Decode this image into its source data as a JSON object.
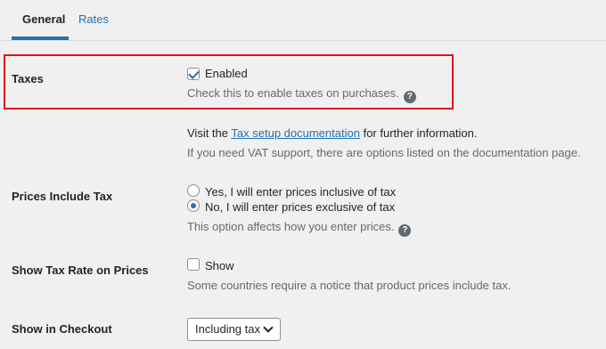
{
  "tabs": [
    {
      "label": "General",
      "active": true
    },
    {
      "label": "Rates",
      "active": false
    }
  ],
  "taxes": {
    "label": "Taxes",
    "checkbox_label": "Enabled",
    "checked": true,
    "description": "Check this to enable taxes on purchases.",
    "help_icon": "question-circle-icon"
  },
  "info": {
    "line1_prefix": "Visit the",
    "line1_link": "Tax setup documentation",
    "line1_suffix": "for further information.",
    "line2": "If you need VAT support, there are options listed on the documentation page."
  },
  "prices_include_tax": {
    "label": "Prices Include Tax",
    "options": [
      {
        "label": "Yes, I will enter prices inclusive of tax",
        "checked": false
      },
      {
        "label": "No, I will enter prices exclusive of tax",
        "checked": true
      }
    ],
    "description": "This option affects how you enter prices."
  },
  "show_tax_rate": {
    "label": "Show Tax Rate on Prices",
    "checkbox_label": "Show",
    "checked": false,
    "description": "Some countries require a notice that product prices include tax."
  },
  "show_in_checkout": {
    "label": "Show in Checkout",
    "selected": "Including tax"
  },
  "colors": {
    "accent": "#2271b1",
    "highlight_border": "#e0121b",
    "background": "#f0f0f1"
  }
}
